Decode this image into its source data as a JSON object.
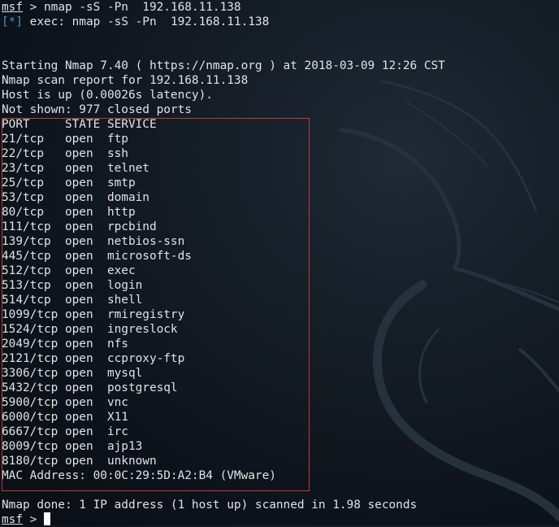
{
  "session": {
    "prompt_name": "msf",
    "prompt_suffix": " > ",
    "command": "nmap -sS -Pn  192.168.11.138",
    "exec_tag": "[*]",
    "exec_line": " exec: nmap -sS -Pn  192.168.11.138"
  },
  "scan": {
    "starting": "Starting Nmap 7.40 ( https://nmap.org ) at 2018-03-09 12:26 CST",
    "report_for": "Nmap scan report for 192.168.11.138",
    "host_up": "Host is up (0.00026s latency).",
    "not_shown": "Not shown: 977 closed ports",
    "header": "PORT     STATE SERVICE",
    "ports": [
      "21/tcp   open  ftp",
      "22/tcp   open  ssh",
      "23/tcp   open  telnet",
      "25/tcp   open  smtp",
      "53/tcp   open  domain",
      "80/tcp   open  http",
      "111/tcp  open  rpcbind",
      "139/tcp  open  netbios-ssn",
      "445/tcp  open  microsoft-ds",
      "512/tcp  open  exec",
      "513/tcp  open  login",
      "514/tcp  open  shell",
      "1099/tcp open  rmiregistry",
      "1524/tcp open  ingreslock",
      "2049/tcp open  nfs",
      "2121/tcp open  ccproxy-ftp",
      "3306/tcp open  mysql",
      "5432/tcp open  postgresql",
      "5900/tcp open  vnc",
      "6000/tcp open  X11",
      "6667/tcp open  irc",
      "8009/tcp open  ajp13",
      "8180/tcp open  unknown"
    ],
    "mac": "MAC Address: 00:0C:29:5D:A2:B4 (VMware)",
    "done": "Nmap done: 1 IP address (1 host up) scanned in 1.98 seconds"
  },
  "final_prompt": {
    "name": "msf",
    "suffix": " > "
  },
  "colors": {
    "highlight_border": "#c23a37",
    "info_blue": "#4a8fd4",
    "text": "#dfe3e6"
  },
  "icons": {
    "background": "kali-dragon-logo",
    "cursor": "block-cursor"
  }
}
